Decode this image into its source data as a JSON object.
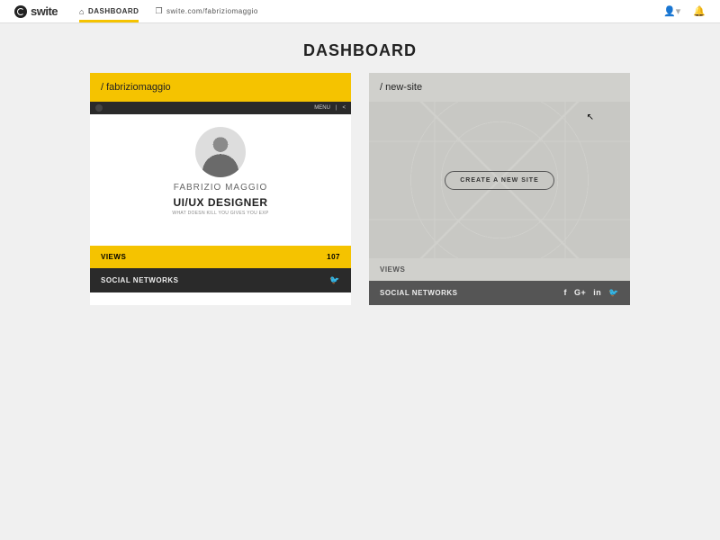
{
  "header": {
    "brand": "swite",
    "nav": [
      {
        "label": "DASHBOARD",
        "active": true
      },
      {
        "label": "swite.com/fabriziomaggio",
        "active": false
      }
    ],
    "page_title": "DASHBOARD"
  },
  "cards": [
    {
      "slug": "/ fabriziomaggio",
      "preview": {
        "menu_label": "MENU",
        "name": "FABRIZIO MAGGIO",
        "role": "UI/UX DESIGNER",
        "tagline": "WHAT DOESN KILL YOU GIVES YOU EXP",
        "footer_tags": ""
      },
      "views_label": "VIEWS",
      "views_count": "107",
      "social_label": "SOCIAL NETWORKS",
      "social_icons": [
        "twitter"
      ]
    },
    {
      "slug": "/ new-site",
      "create_label": "CREATE A NEW SITE",
      "views_label": "VIEWS",
      "views_count": "",
      "social_label": "SOCIAL NETWORKS",
      "social_icons": [
        "facebook",
        "google-plus",
        "linkedin",
        "twitter"
      ]
    }
  ],
  "icons": {
    "home": "⌂",
    "link": "❐",
    "user": "👤",
    "chevron_down": "▾",
    "bell": "🔔",
    "share": "⫘",
    "twitter": "𝕏",
    "facebook": "f",
    "google_plus": "G+",
    "linkedin": "in"
  },
  "colors": {
    "accent": "#f5c300",
    "dark": "#2a2a2a",
    "grey": "#d0d0cc"
  }
}
